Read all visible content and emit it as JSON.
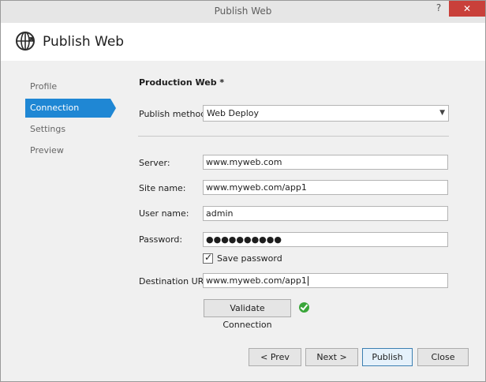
{
  "window": {
    "title": "Publish Web",
    "help_label": "?",
    "close_label": "✕"
  },
  "header": {
    "title": "Publish Web",
    "icon": "globe-publish-icon"
  },
  "nav": {
    "items": [
      {
        "label": "Profile"
      },
      {
        "label": "Connection"
      },
      {
        "label": "Settings"
      },
      {
        "label": "Preview"
      }
    ],
    "active": "Connection"
  },
  "main": {
    "section_title": "Production Web *",
    "publish_method": {
      "label": "Publish method:",
      "value": "Web Deploy"
    },
    "server": {
      "label": "Server:",
      "value": "www.myweb.com"
    },
    "site_name": {
      "label": "Site name:",
      "value": "www.myweb.com/app1"
    },
    "user_name": {
      "label": "User name:",
      "value": "admin"
    },
    "password": {
      "label": "Password:",
      "value": "●●●●●●●●●●"
    },
    "save_password": {
      "label": "Save password",
      "checked": true
    },
    "destination_url": {
      "label": "Destination URL:",
      "value": "www.myweb.com/app1"
    },
    "validate_button": "Validate Connection",
    "validation_status_icon": "check-circle-icon"
  },
  "footer": {
    "prev": "< Prev",
    "next": "Next >",
    "publish": "Publish",
    "close": "Close"
  },
  "colors": {
    "accent": "#1f87d4",
    "close_button": "#c9403a",
    "success": "#3aa63a"
  }
}
